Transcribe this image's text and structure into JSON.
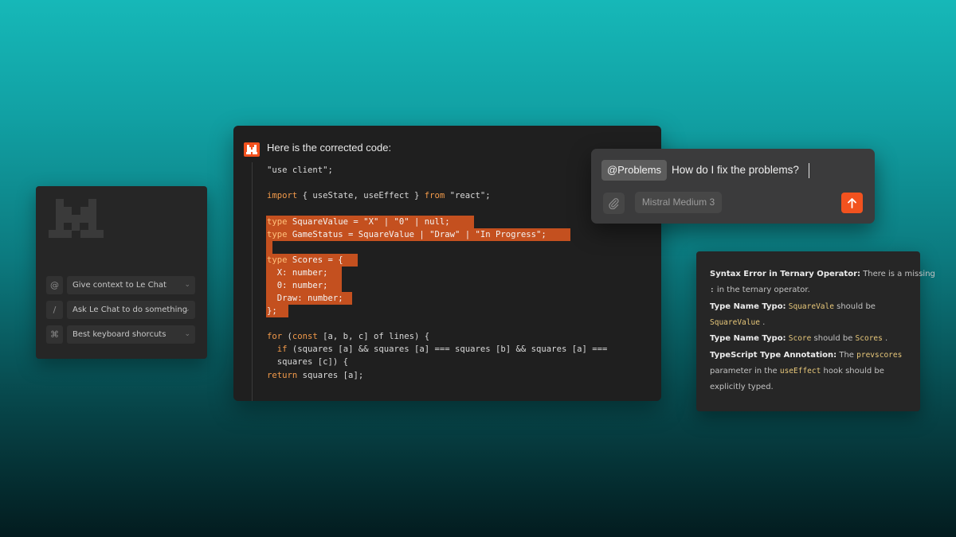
{
  "left_panel": {
    "logo": "mistral-logo-icon",
    "hints": [
      {
        "icon_char": "@",
        "icon": "at-icon",
        "label": "Give context to Le Chat"
      },
      {
        "icon_char": "/",
        "icon": "slash-icon",
        "label": "Ask Le Chat to do something"
      },
      {
        "icon_char": "⌘",
        "icon": "keyboard-icon",
        "label": "Best keyboard shorcuts"
      }
    ],
    "chevron": "⌄"
  },
  "reply": {
    "title": "Here is the corrected code:",
    "code": [
      "\"use client\";",
      "import { useState, useEffect } from \"react\";",
      "type SquareValue = \"X\" | \"0\" | null;",
      "type GameStatus = SquareValue | \"Draw\" | \"In Progress\";",
      "type Scores = {",
      "  X: number;",
      "  0: number;",
      "  Draw: number;",
      "};",
      "for (const [a, b, c] of lines) {",
      "  if (squares [a] && squares [a] === squares [b] && squares [a] ===",
      "  squares [c]) {",
      "return squares [a];"
    ]
  },
  "chat": {
    "mention": "@Problems",
    "message": "How do I fix the problems?",
    "model": "Mistral Medium 3",
    "colors": {
      "accent": "#f2521f"
    }
  },
  "problems": {
    "lines": [
      {
        "bold": "Syntax Error in Ternary Operator:",
        "text": " There is a missing"
      },
      {
        "code": ":",
        "text": " in the ternary operator."
      },
      {
        "bold": "Type Name Typo:",
        "text": " ",
        "code": "SquareVale",
        "text2": " should be"
      },
      {
        "code": "SquareValue",
        "text": " ."
      },
      {
        "bold": "Type Name Typo:",
        "text": " ",
        "code": "Score",
        "text2": " should be ",
        "code2": "Scores",
        "text3": " ."
      },
      {
        "bold": "TypeScript Type Annotation:",
        "text": " The ",
        "code": "prevscores"
      },
      {
        "text": "parameter in the ",
        "code": "useEffect",
        "text2": "  hook should be"
      },
      {
        "text": "explicitly typed."
      }
    ]
  }
}
